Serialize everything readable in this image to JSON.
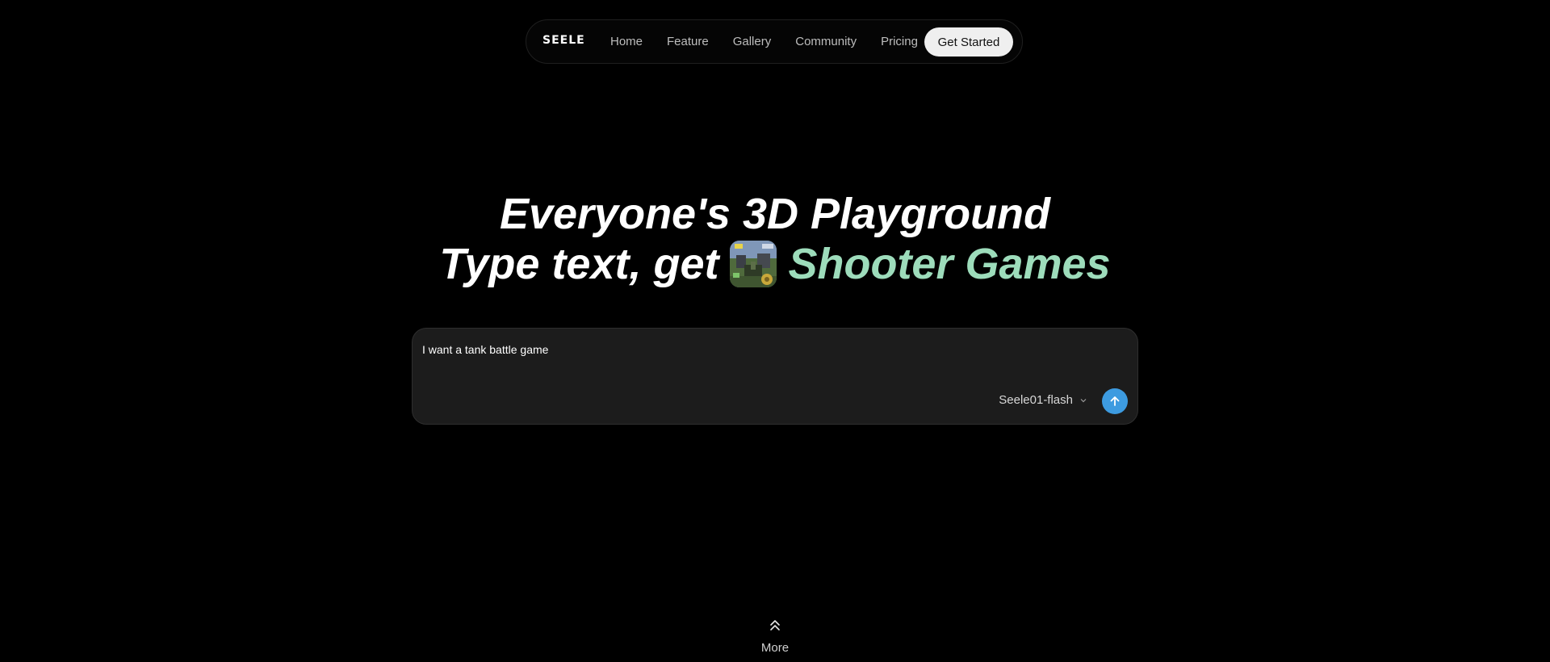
{
  "nav": {
    "logo": "SEELE",
    "links": [
      "Home",
      "Feature",
      "Gallery",
      "Community",
      "Pricing"
    ],
    "cta_label": "Get Started"
  },
  "hero": {
    "line1": "Everyone's 3D Playground",
    "line2_prefix": "Type text, get",
    "line2_highlight": "Shooter Games",
    "accent_color": "#9ddcbb"
  },
  "prompt": {
    "value": "I want a tank battle game",
    "model": "Seele01-flash",
    "send_color": "#3d9be0"
  },
  "more": {
    "label": "More"
  }
}
